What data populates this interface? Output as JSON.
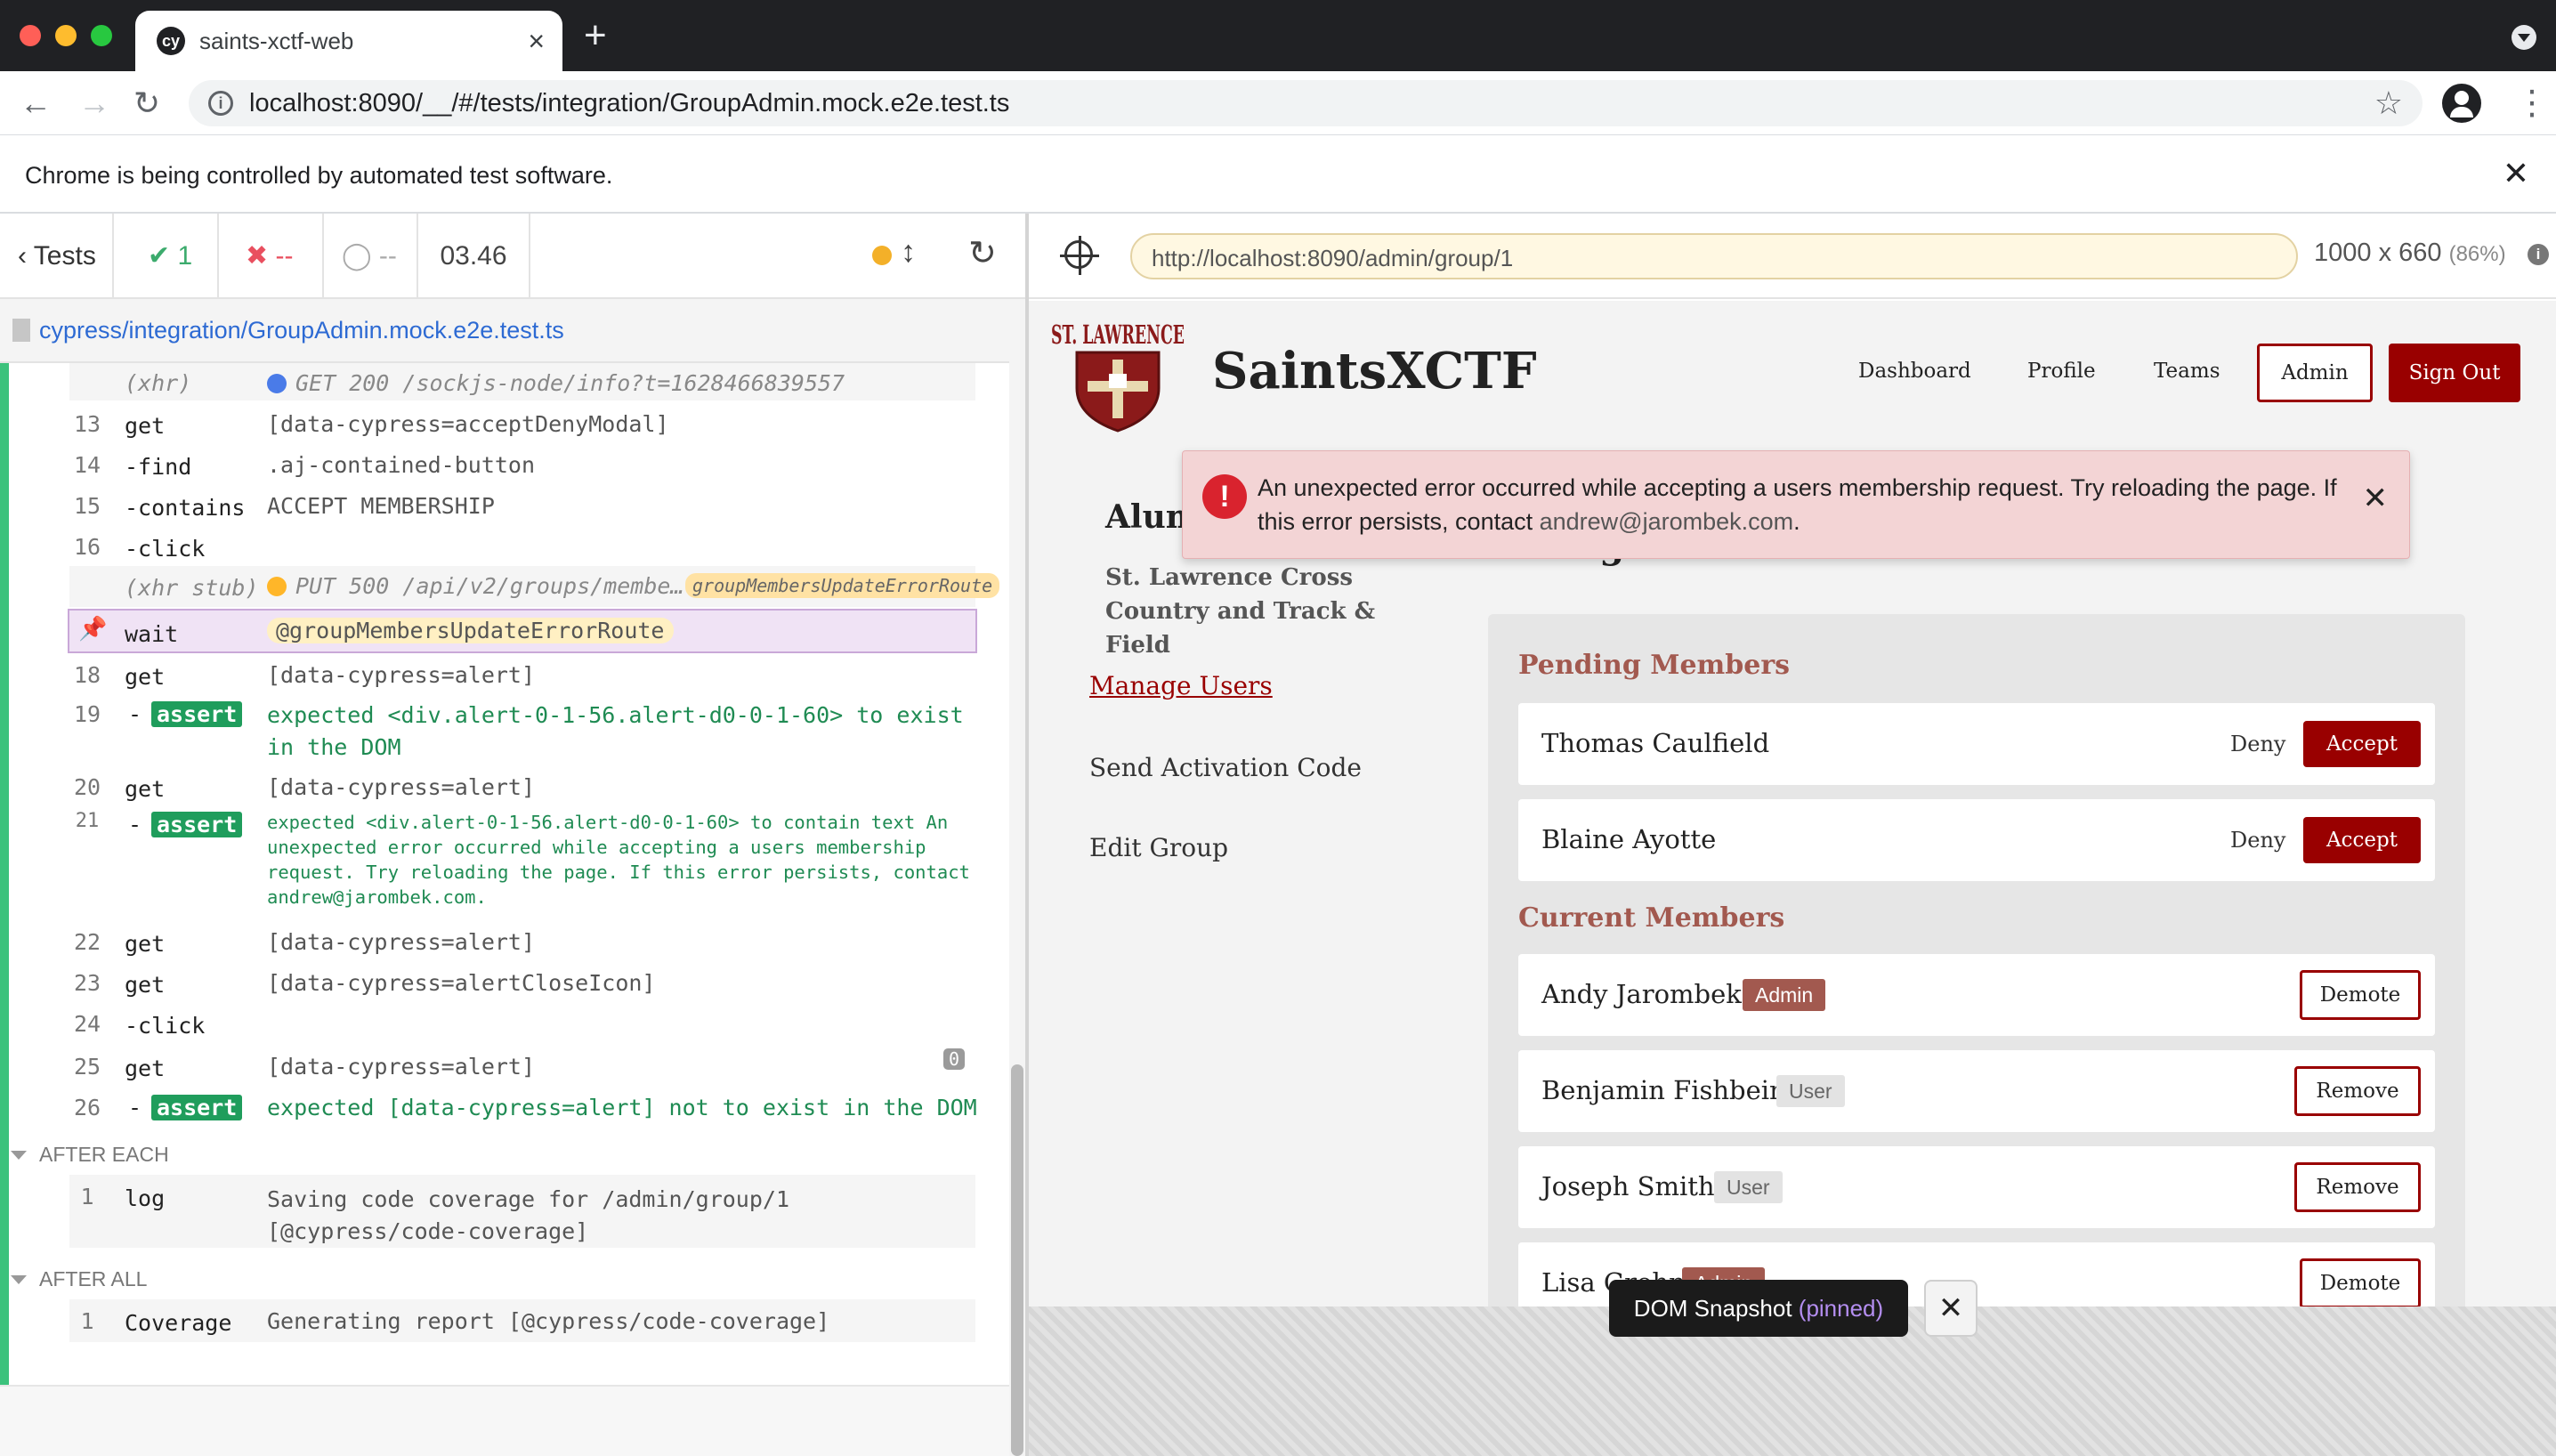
{
  "browser": {
    "tab_title": "saints-xctf-web",
    "tab_favicon": "cy",
    "url": "localhost:8090/__/#/tests/integration/GroupAdmin.mock.e2e.test.ts",
    "infobar": "Chrome is being controlled by automated test software."
  },
  "reporter": {
    "tests_label": "Tests",
    "passed": "1",
    "failed": "--",
    "pending": "--",
    "duration": "03.46",
    "spec_path": "cypress/integration/GroupAdmin.mock.e2e.test.ts",
    "commands": [
      {
        "num": "",
        "name": "(xhr)",
        "msg": "GET 200 /sockjs-node/info?t=1628466839557"
      },
      {
        "num": "13",
        "name": "get",
        "msg": "[data-cypress=acceptDenyModal]"
      },
      {
        "num": "14",
        "name": "-find",
        "msg": ".aj-contained-button"
      },
      {
        "num": "15",
        "name": "-contains",
        "msg": "ACCEPT MEMBERSHIP"
      },
      {
        "num": "16",
        "name": "-click",
        "msg": ""
      },
      {
        "num": "",
        "name": "(xhr stub)",
        "msg": "PUT 500 /api/v2/groups/membe…",
        "alias": "groupMembersUpdateErrorRoute"
      },
      {
        "num": "",
        "name": "wait",
        "msg": "@groupMembersUpdateErrorRoute"
      },
      {
        "num": "18",
        "name": "get",
        "msg": "[data-cypress=alert]"
      },
      {
        "num": "19",
        "name": "assert",
        "msg": "expected <div.alert-0-1-56.alert-d0-0-1-60> to exist in the DOM"
      },
      {
        "num": "20",
        "name": "get",
        "msg": "[data-cypress=alert]"
      },
      {
        "num": "21",
        "name": "assert",
        "msg": "expected <div.alert-0-1-56.alert-d0-0-1-60> to contain text An unexpected error occurred while accepting a users membership request. Try reloading the page. If this error persists, contact andrew@jarombek.com."
      },
      {
        "num": "22",
        "name": "get",
        "msg": "[data-cypress=alert]"
      },
      {
        "num": "23",
        "name": "get",
        "msg": "[data-cypress=alertCloseIcon]"
      },
      {
        "num": "24",
        "name": "-click",
        "msg": ""
      },
      {
        "num": "25",
        "name": "get",
        "msg": "[data-cypress=alert]",
        "badge": "0"
      },
      {
        "num": "26",
        "name": "assert",
        "msg": "expected [data-cypress=alert] not to exist in the DOM"
      }
    ],
    "assert_label": "assert",
    "assert_dash": "-",
    "after_each_label": "AFTER EACH",
    "after_each": {
      "num": "1",
      "name": "log",
      "msg": "Saving code coverage for /admin/group/1 [@cypress/code-coverage]"
    },
    "after_all_label": "AFTER ALL",
    "after_all": {
      "num": "1",
      "name": "Coverage",
      "msg": "Generating report [@cypress/code-coverage]"
    }
  },
  "aut": {
    "url": "http://localhost:8090/admin/group/1",
    "viewport": "1000 x 660",
    "viewport_pct": "(86%)"
  },
  "site": {
    "title": "SaintsXCTF",
    "logo_text": "ST. LAWRENCE",
    "nav": {
      "dashboard": "Dashboard",
      "profile": "Profile",
      "teams": "Teams",
      "admin": "Admin",
      "signout": "Sign Out"
    },
    "sidebar_title": "Alum",
    "sidebar_subtitle": "St. Lawrence Cross Country and Track & Field",
    "sidebar_links": [
      "Manage Users",
      "Send Activation Code",
      "Edit Group"
    ],
    "main_heading": "Manage Users",
    "pending_title": "Pending Members",
    "pending": [
      {
        "name": "Thomas Caulfield",
        "deny": "Deny",
        "accept": "Accept"
      },
      {
        "name": "Blaine Ayotte",
        "deny": "Deny",
        "accept": "Accept"
      }
    ],
    "current_title": "Current Members",
    "current": [
      {
        "name": "Andy Jarombek",
        "role": "Admin",
        "action": "Demote"
      },
      {
        "name": "Benjamin Fishbein",
        "role": "User",
        "action": "Remove"
      },
      {
        "name": "Joseph Smith",
        "role": "User",
        "action": "Remove"
      },
      {
        "name": "Lisa Grohn",
        "role": "Admin",
        "action": "Demote"
      }
    ],
    "alert": {
      "text": "An unexpected error occurred while accepting a users membership request. Try reloading the page. If this error persists, contact",
      "email": "andrew@jarombek.com",
      "end": "."
    }
  },
  "snapshot": {
    "label": "DOM Snapshot",
    "pinned": "(pinned)"
  }
}
